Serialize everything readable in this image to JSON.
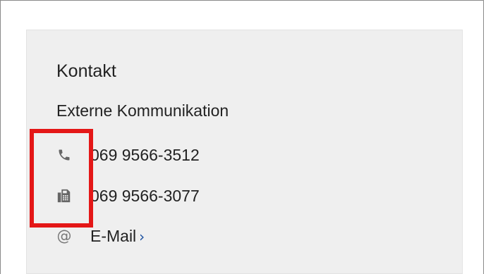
{
  "contact": {
    "title": "Kontakt",
    "department": "Externe Kommunikation",
    "phone": {
      "icon": "phone-icon",
      "number": "069 9566-3512"
    },
    "fax": {
      "icon": "fax-icon",
      "number": "069 9566-3077"
    },
    "email": {
      "icon": "at-sign-icon",
      "at_symbol": "@",
      "label": "E-Mail",
      "chevron": "›"
    }
  },
  "colors": {
    "card_background": "#efefef",
    "highlight_box": "#e41717",
    "link_chevron": "#1a4fa0",
    "icon": "#666666"
  }
}
